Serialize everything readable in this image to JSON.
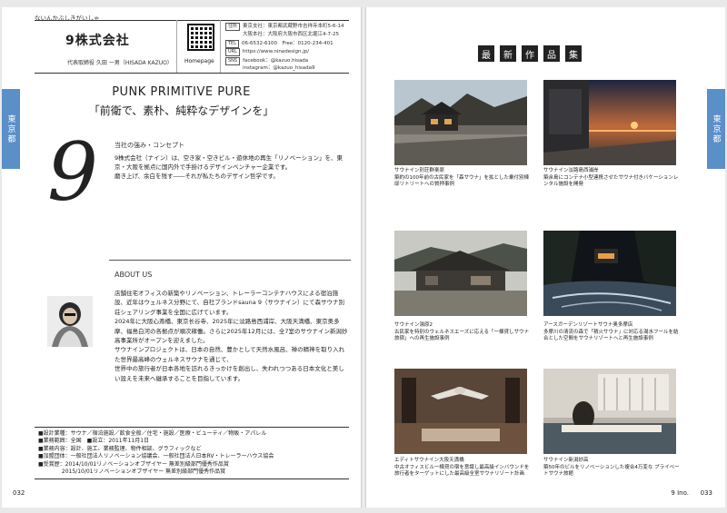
{
  "left_page": {
    "tab_label": "東京都",
    "furigana": "ないんかぶしきがいしゃ",
    "company_name": "9株式会社",
    "representative": "代表取締役 久田 一男（HISADA KAZUO）",
    "qr_label": "Homepage",
    "contact": [
      {
        "tag": "住所",
        "text": "東京支社：東京都武蔵野市吉祥寺本町5-6-14"
      },
      {
        "tag": "",
        "text": "大阪本社：大阪府大阪市西区北堀江4-7-25"
      },
      {
        "tag": "TEL",
        "text": "06-6532-6100　Free：0120-234-401"
      },
      {
        "tag": "URL",
        "text": "https://www.ninedesign.jp/"
      },
      {
        "tag": "SNS",
        "text": "facebook：@kazuo.hisada"
      },
      {
        "tag": "",
        "text": "instagram：@kazuo_hisada9"
      }
    ],
    "headline_en": "PUNK PRIMITIVE PURE",
    "headline_jp": "「前衛で、素朴、純粋なデザインを」",
    "logo_numeral": "9",
    "concept_label": "当社の強み・コンセプト",
    "concept_body": "9株式会社（ナイン）は、空き家・空きビル・遊休地の再生「リノベーション」を、東京・大阪を拠点に国内外で手掛けるデザインベンチャー企業です。\n磨き上げ、余白を残す――それが私たちのデザイン哲学です。",
    "about_label": "ABOUT US",
    "about_body": "店舗住宅オフィスの新築やリノベーション、トレーラーコンテナハウスによる宿泊施設、近年はウェルネス分野にて、自社ブランドsauna 9（サウナイン）にて森サウナ別荘シェアリング事業を全国に広げています。\n2024年に大阪心斎橋、東京长谷寺、2025年に淡路島西浦岸、大阪天満橋、東京奥多摩、福島白河の各拠点が順次稼働。さらに2025年12月には、全7室のサウナイン新潟妙高事業所がオープンを迎えました。\nサウナインプロジェクトは、日本の自然、豊かとして天然水風呂、禅の精神を取り入れた世界最高峰のウェルネスサウナを通じて、\n世界中の旅行者が日本各地を訪れるきっかけを創出し、失われつつある日本文化と美しい設えを未来へ継承することを目指しています。",
    "info": [
      "■設計業種：サウナ／宿泊施設／飲食全般／住宅・施設／医療・ビューティ／物販・アパレル",
      "■業務範囲：全国　■設立：2011年11月1日",
      "■業務内容：設計、施工、業務監理、物件相談、グラフィックなど",
      "■加盟団体：一般社団法人リノベーション協議会、一般社団法人日本RV・トレーラーハウス協会",
      "■受賞歴：2014/10/01リノベーションオブザイヤー 無差別級部門優秀作品賞",
      "　　　　 2015/10/01リノベーションオブザイヤー 無差別級部門優秀作品賞"
    ],
    "page_number": "032"
  },
  "right_page": {
    "tab_label": "東京都",
    "section_title": [
      "最",
      "新",
      "作",
      "品",
      "集"
    ],
    "captions": [
      "サウナイン別荘群楽原\n築約の100年前の古民家を「森サウナ」を拡とした乗付別棟邸リトリートへの質押事例",
      "サウナイン淡路島西浦岸\n築余島にコンテナ小型連携させたサウナ付きバケーションレンタル施設を開発",
      "サウナイン湯原2\n古民家を特別のウェルネスエーズに応える「一棟貸しサウナ旅宿」への再生施設事例",
      "アースガーデンリゾートサウナ奥多摩店\n多摩川の清流の森で「積火サウナ」に対応る湯水フールを結合とした空間をサウナリゾートへと再生施設事例",
      "エディトサウナイン大阪天満橋\n中古オフィスビル一棟貸の宿を意識し最高級インバウンドを旅行者をターゲットにした最高級全室サウナリゾート計画",
      "サウナイン新潟妙高\n築50年のビルをリノベーションした複合4万変な プライベートサウナ旅館"
    ],
    "page_name": "9 Ino.",
    "page_number": "033"
  }
}
